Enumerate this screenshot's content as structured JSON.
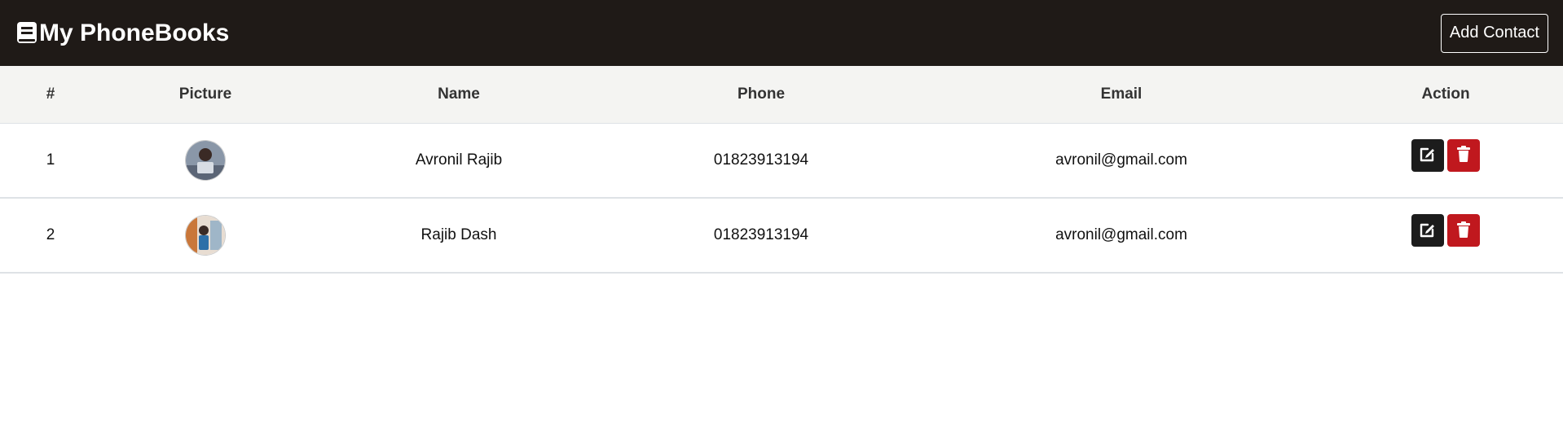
{
  "navbar": {
    "brand_label": "My PhoneBooks",
    "brand_icon": "book-icon",
    "add_contact_label": "Add Contact"
  },
  "table": {
    "columns": [
      "#",
      "Picture",
      "Name",
      "Phone",
      "Email",
      "Action"
    ],
    "rows": [
      {
        "index": "1",
        "picture": "avatar-photo",
        "name": "Avronil Rajib",
        "phone": "01823913194",
        "email": "avronil@gmail.com"
      },
      {
        "index": "2",
        "picture": "avatar-photo",
        "name": "Rajib Dash",
        "phone": "01823913194",
        "email": "avronil@gmail.com"
      }
    ],
    "action_icons": [
      "edit-icon",
      "trash-icon"
    ]
  },
  "colors": {
    "navbar_bg": "#1f1a17",
    "header_bg": "#f4f4f2",
    "edit_button": "#1c1c1c",
    "delete_button": "#c0181e"
  }
}
